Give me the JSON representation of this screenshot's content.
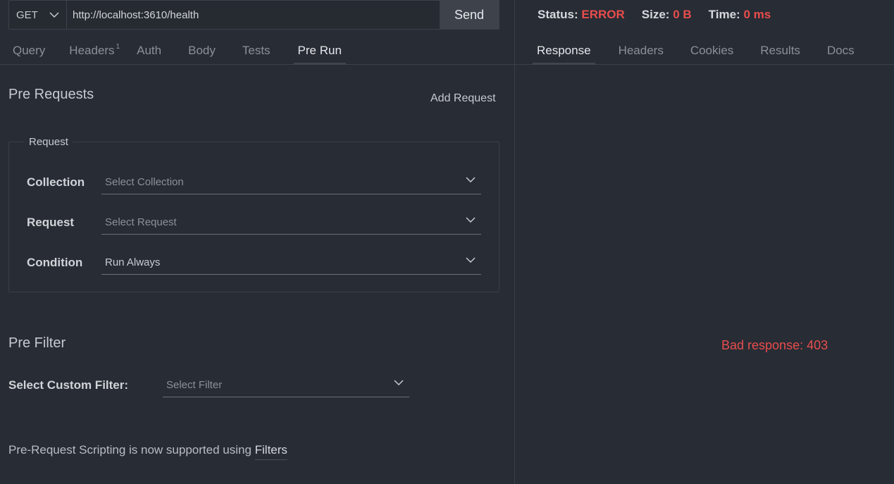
{
  "request": {
    "method": "GET",
    "url": "http://localhost:3610/health",
    "send_label": "Send"
  },
  "request_tabs": [
    {
      "label": "Query"
    },
    {
      "label": "Headers",
      "badge": "1"
    },
    {
      "label": "Auth"
    },
    {
      "label": "Body"
    },
    {
      "label": "Tests"
    },
    {
      "label": "Pre Run",
      "active": true
    }
  ],
  "pre_requests": {
    "title": "Pre Requests",
    "add_label": "Add Request",
    "box_legend": "Request",
    "fields": {
      "collection": {
        "label": "Collection",
        "placeholder": "Select Collection"
      },
      "request": {
        "label": "Request",
        "placeholder": "Select Request"
      },
      "condition": {
        "label": "Condition",
        "value": "Run Always"
      }
    }
  },
  "pre_filter": {
    "title": "Pre Filter",
    "label": "Select Custom Filter:",
    "placeholder": "Select Filter"
  },
  "footer": {
    "text": "Pre-Request Scripting is now supported using ",
    "link": "Filters"
  },
  "status": {
    "status_label": "Status:",
    "status_value": "ERROR",
    "size_label": "Size:",
    "size_value": "0 B",
    "time_label": "Time:",
    "time_value": "0 ms"
  },
  "response_tabs": [
    {
      "label": "Response",
      "active": true
    },
    {
      "label": "Headers"
    },
    {
      "label": "Cookies"
    },
    {
      "label": "Results"
    },
    {
      "label": "Docs"
    }
  ],
  "response": {
    "error_message": "Bad response: 403"
  },
  "colors": {
    "background": "#282c34",
    "error": "#e84d4d",
    "send_button": "#3d424b"
  },
  "icons": {
    "dropdown": "chevron-down-icon"
  }
}
